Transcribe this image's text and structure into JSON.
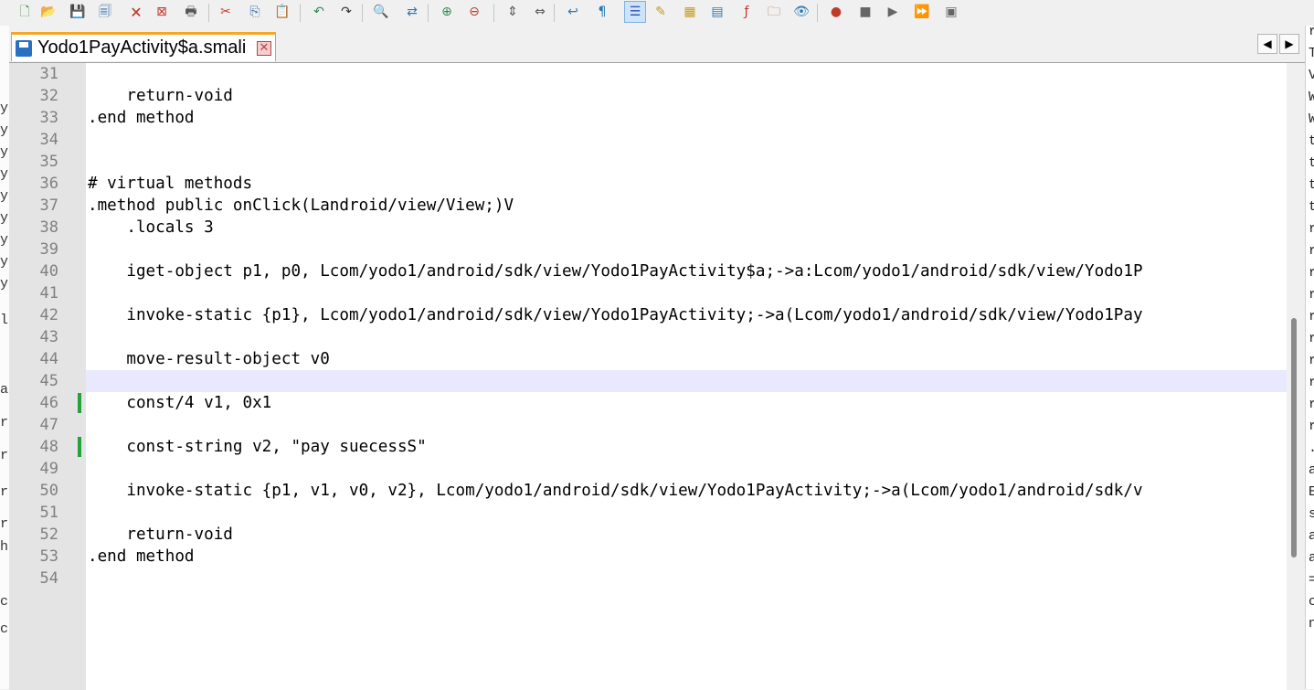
{
  "toolbar": {
    "icons": [
      "new-file",
      "open-file",
      "save",
      "save-all",
      "close",
      "close-all",
      "print",
      "cut",
      "copy",
      "paste",
      "undo",
      "redo",
      "find",
      "replace",
      "zoom-in",
      "zoom-out",
      "sync-vertical",
      "sync-horizontal",
      "word-wrap",
      "show-all-chars",
      "indent-guide",
      "user-language",
      "doc-map",
      "doc-list",
      "function-list",
      "folder-workspace",
      "monitoring",
      "record-macro",
      "stop-macro",
      "play-macro",
      "run-macro-multiple",
      "save-macro"
    ],
    "active_icon": "indent-guide"
  },
  "tab": {
    "title": "Yodo1PayActivity$a.smali",
    "close_glyph": "✕"
  },
  "tab_nav": {
    "prev": "◀",
    "next": "▶"
  },
  "editor": {
    "current_line": "45",
    "changed_lines": [
      "46",
      "48"
    ],
    "lines": [
      {
        "num": "31",
        "text": ""
      },
      {
        "num": "32",
        "text": "    return-void"
      },
      {
        "num": "33",
        "text": ".end method"
      },
      {
        "num": "34",
        "text": ""
      },
      {
        "num": "35",
        "text": ""
      },
      {
        "num": "36",
        "text": "# virtual methods"
      },
      {
        "num": "37",
        "text": ".method public onClick(Landroid/view/View;)V"
      },
      {
        "num": "38",
        "text": "    .locals 3"
      },
      {
        "num": "39",
        "text": ""
      },
      {
        "num": "40",
        "text": "    iget-object p1, p0, Lcom/yodo1/android/sdk/view/Yodo1PayActivity$a;->a:Lcom/yodo1/android/sdk/view/Yodo1P"
      },
      {
        "num": "41",
        "text": ""
      },
      {
        "num": "42",
        "text": "    invoke-static {p1}, Lcom/yodo1/android/sdk/view/Yodo1PayActivity;->a(Lcom/yodo1/android/sdk/view/Yodo1Pay"
      },
      {
        "num": "43",
        "text": ""
      },
      {
        "num": "44",
        "text": "    move-result-object v0"
      },
      {
        "num": "45",
        "text": ""
      },
      {
        "num": "46",
        "text": "    const/4 v1, 0x1"
      },
      {
        "num": "47",
        "text": ""
      },
      {
        "num": "48",
        "text": "    const-string v2, \"pay suecessS\""
      },
      {
        "num": "49",
        "text": ""
      },
      {
        "num": "50",
        "text": "    invoke-static {p1, v1, v0, v2}, Lcom/yodo1/android/sdk/view/Yodo1PayActivity;->a(Lcom/yodo1/android/sdk/v"
      },
      {
        "num": "51",
        "text": ""
      },
      {
        "num": "52",
        "text": "    return-void"
      },
      {
        "num": "53",
        "text": ".end method"
      },
      {
        "num": "54",
        "text": ""
      }
    ]
  },
  "left_sliver_chars": [
    "y",
    "y",
    "y",
    "y",
    "y",
    "y",
    "y",
    "y",
    "y",
    "li",
    "a",
    "ri",
    "ri",
    "ri",
    "ri",
    "h",
    "ct",
    "ct"
  ],
  "right_sliver_chars": [
    "i",
    "r",
    "T",
    "V",
    "W",
    "W",
    "t",
    "t",
    "t",
    "t",
    "r",
    "r",
    "r",
    "r",
    "r",
    "r",
    "r",
    "r",
    "r",
    "r",
    ".",
    "a",
    "E",
    "s",
    "a",
    "a",
    "=",
    "c",
    "n"
  ]
}
